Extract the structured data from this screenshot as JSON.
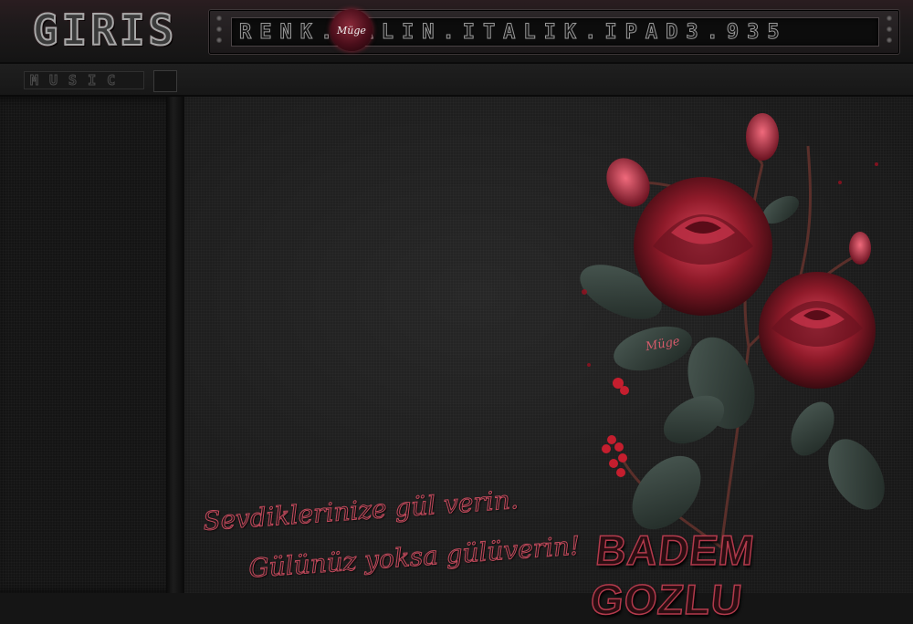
{
  "header": {
    "logo_text": "GIRIS",
    "marquee_text": "RENK.KALIN.ITALIK.IPAD3.935",
    "badge_text": "Müge"
  },
  "music": {
    "label": "MUSIC"
  },
  "content": {
    "tagline_line1": "Sevdiklerinize gül verin.",
    "tagline_line2": "Gülünüz yoksa gülüverin!",
    "signature": "BADEM GOZLU",
    "watermark": "Müge"
  },
  "colors": {
    "accent": "#c24a5c",
    "background": "#151515",
    "rose": "#9e1f2e",
    "leaf": "#2f3b36"
  }
}
